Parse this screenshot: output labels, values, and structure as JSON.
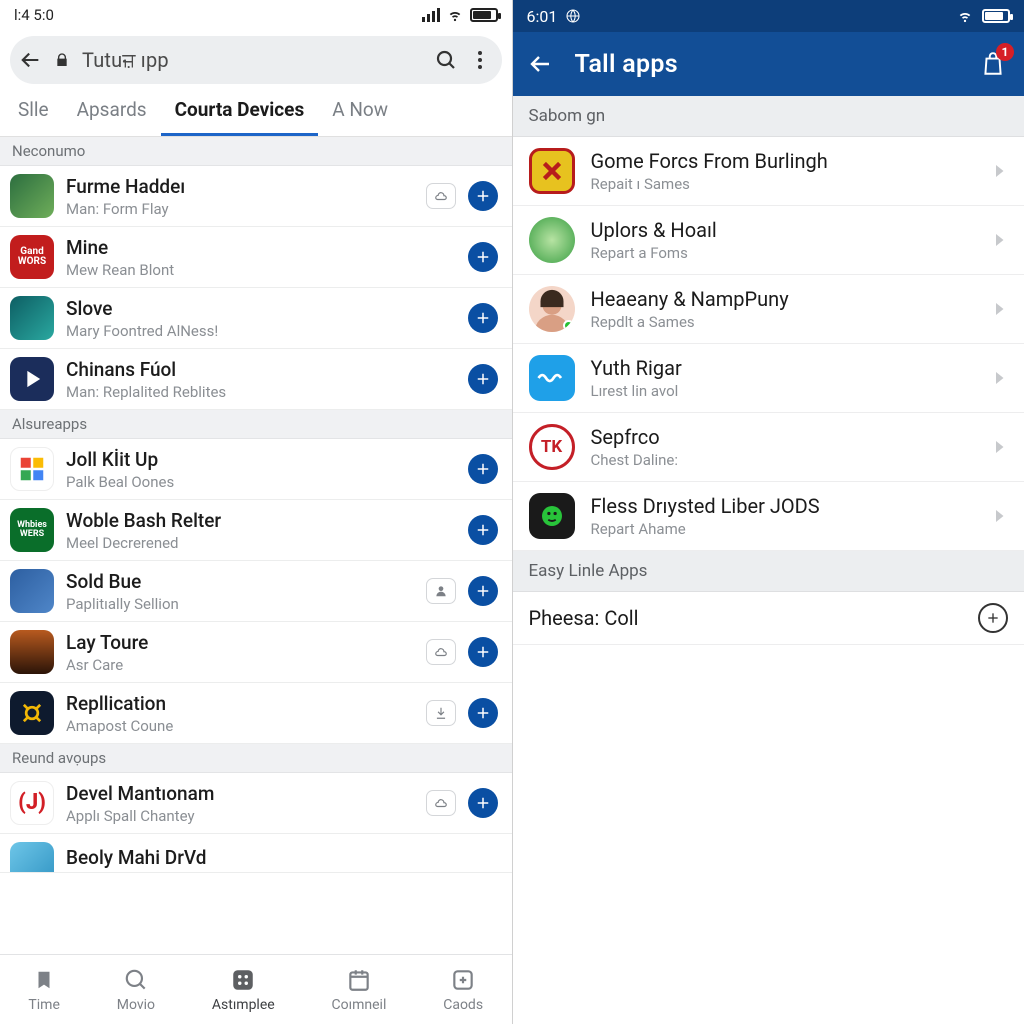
{
  "left": {
    "status_time": "l:4 5:0",
    "search_text": "Tutuਜ਼ ıpp",
    "tabs": [
      "Slle",
      "Apsards",
      "Courta Devices",
      "A Now"
    ],
    "active_tab": 2,
    "sections": [
      {
        "header": "Neconumo",
        "apps": [
          {
            "title": "Furme Haddeı",
            "sub": "Man: Form Flay",
            "icon_bg": "linear-gradient(135deg,#2c6e3f,#6fae5a)",
            "icon_txt": "",
            "mini": true
          },
          {
            "title": "Mine",
            "sub": "Mew Rean Blont",
            "icon_bg": "#c21d1d",
            "icon_txt": "Gane\nWors",
            "mini": false
          },
          {
            "title": "Slove",
            "sub": "Mary Foontred AlNess!",
            "icon_bg": "linear-gradient(135deg,#0d5e63,#2aa8a0)",
            "icon_txt": "",
            "mini": false
          },
          {
            "title": "Chinans Fúol",
            "sub": "Man: Replalited Reblites",
            "icon_bg": "#1b2d5b",
            "icon_txt": "",
            "mini": false
          }
        ]
      },
      {
        "header": "Alsureapps",
        "apps": [
          {
            "title": "Joll Kİit Up",
            "sub": "Palk Beal Oones",
            "icon_bg": "#fff",
            "icon_txt": "",
            "mini": false,
            "google": true
          },
          {
            "title": "Woble Bash Relter",
            "sub": "Meel Decrerened",
            "icon_bg": "#0a6e2a",
            "icon_txt": "Whbies\nWers",
            "mini": false
          },
          {
            "title": "Sold Bue",
            "sub": "Paplitıally Sellion",
            "icon_bg": "linear-gradient(135deg,#2d5fa1,#4f86c8)",
            "icon_txt": "",
            "mini": true,
            "mini_icon": "person"
          },
          {
            "title": "Lay Toure",
            "sub": "Asr Care",
            "icon_bg": "linear-gradient(180deg,#b85a1f,#2b1408)",
            "icon_txt": "",
            "mini": true
          },
          {
            "title": "Repllication",
            "sub": "Amapost Coune",
            "icon_bg": "#0e1a2e",
            "icon_txt": "",
            "mini": true,
            "mini_icon": "download",
            "camera": true
          }
        ]
      },
      {
        "header": "Reund avọups",
        "apps": [
          {
            "title": "Devel Mantıonam",
            "sub": "Applı Spall Chantey",
            "icon_bg": "#fff",
            "icon_txt": "",
            "mini": true,
            "brackets": true
          },
          {
            "title": "Beoly Mahi DrVd",
            "sub": "",
            "icon_bg": "linear-gradient(135deg,#6ec6e8,#3a9cc9)",
            "icon_txt": "",
            "mini": false,
            "cut": true
          }
        ]
      }
    ],
    "bottomnav": [
      {
        "label": "Time"
      },
      {
        "label": "Movio"
      },
      {
        "label": "Astımplee",
        "active": true
      },
      {
        "label": "Coımneil"
      },
      {
        "label": "Caods"
      }
    ]
  },
  "right": {
    "status_time": "6:01",
    "header_title": "Tall apps",
    "badge": "1",
    "sections": [
      {
        "header": "Sabom gn",
        "apps": [
          {
            "title": "Gome Forcs From Burlingh",
            "sub": "Repait ı Sames",
            "icon_bg": "#e7c21f",
            "border": "#b71c1c"
          },
          {
            "title": "Uplors & Hoaıl",
            "sub": "Repart a Foms",
            "icon_bg": "radial-gradient(circle,#6fc36a,#2f8a3c)"
          },
          {
            "title": "Heaeany & NampPuny",
            "sub": "Repdlt a Sames",
            "icon_bg": "#f4d6c8",
            "avatar": true
          },
          {
            "title": "Yuth Rigar",
            "sub": "Lırest lin avol",
            "icon_bg": "#1fa0e8",
            "wavy": true
          },
          {
            "title": "Sepfrco",
            "sub": "Chest Daline:",
            "icon_bg": "#fff",
            "border": "#c41f27",
            "tk": true
          },
          {
            "title": "Fless Drıysted Liber JODS",
            "sub": "Repart Ahame",
            "icon_bg": "#1a1a1a",
            "green_face": true
          }
        ]
      },
      {
        "header": "Easy Linle Apps",
        "apps_simple": [
          {
            "title": "Pheesa: Coll"
          }
        ]
      }
    ]
  }
}
